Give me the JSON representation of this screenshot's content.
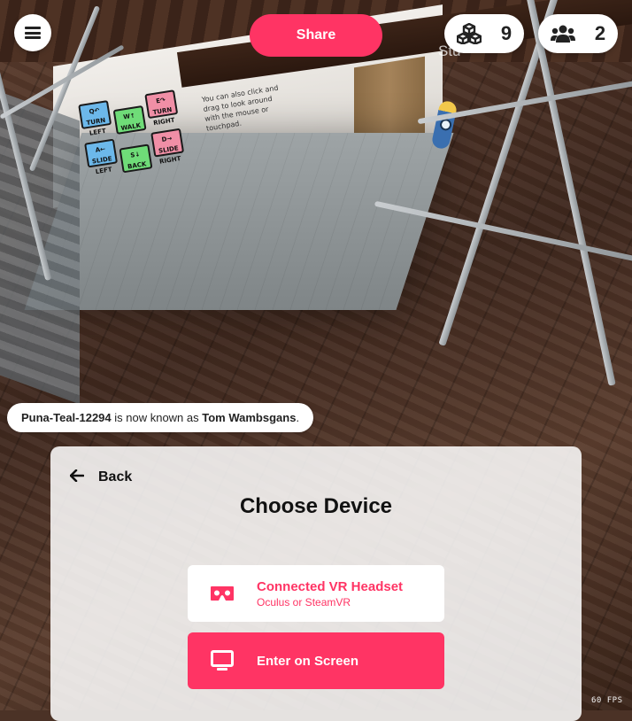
{
  "hud": {
    "share_label": "Share",
    "object_count": "9",
    "people_count": "2",
    "fps_value": "60",
    "fps_unit": "FPS"
  },
  "scene": {
    "sign_hint": "You can also click and drag to look around with the mouse or touchpad.",
    "keys": [
      {
        "label": "Q↶ TURN LEFT",
        "color": "#6cb8ea"
      },
      {
        "label": "W↑ WALK",
        "color": "#6fdc78"
      },
      {
        "label": "E↷ TURN RIGHT",
        "color": "#f08fa6"
      },
      {
        "label": "A← SLIDE LEFT",
        "color": "#6cb8ea"
      },
      {
        "label": "S↓ BACK",
        "color": "#6fdc78"
      },
      {
        "label": "D→ SLIDE RIGHT",
        "color": "#f08fa6"
      }
    ],
    "partial_label": "Stu"
  },
  "notification": {
    "old_name": "Puna-Teal-12294",
    "middle_text": " is now known as ",
    "new_name": "Tom Wambsgans",
    "end_text": "."
  },
  "modal": {
    "back_label": "Back",
    "title": "Choose Device",
    "options": [
      {
        "label": "Connected VR Headset",
        "sublabel": "Oculus or SteamVR",
        "icon": "vr-headset-icon"
      },
      {
        "label": "Enter on Screen",
        "sublabel": "",
        "icon": "monitor-icon"
      }
    ]
  },
  "colors": {
    "accent": "#ff3464",
    "panel": "#ffffff"
  }
}
